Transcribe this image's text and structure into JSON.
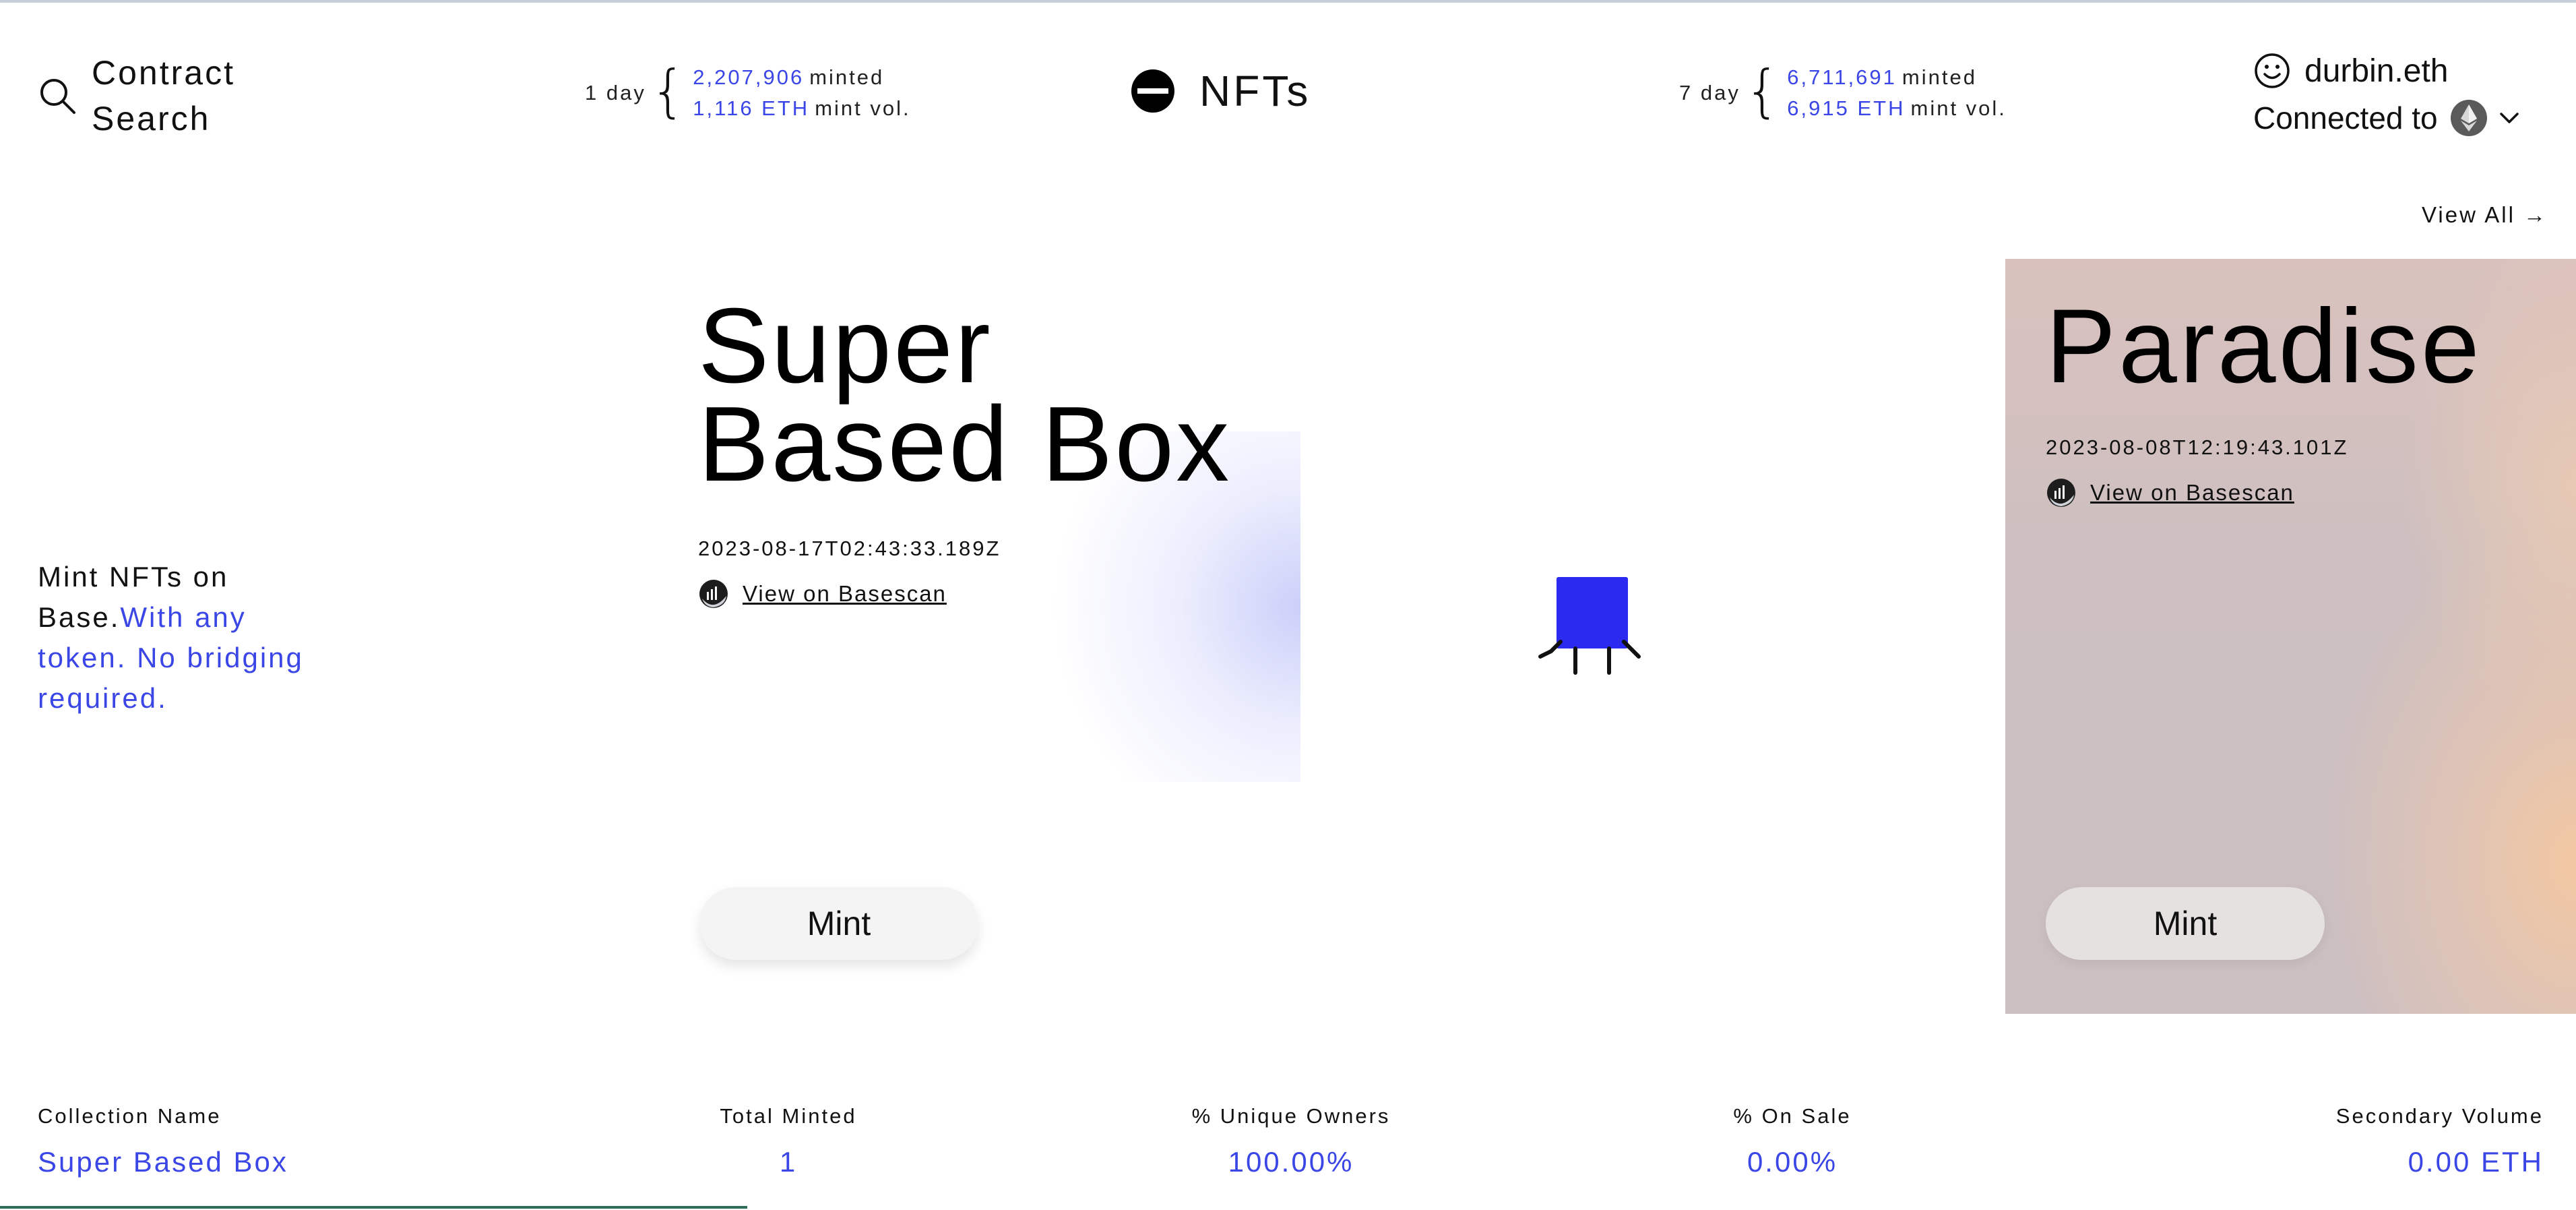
{
  "header": {
    "search_label": "Contract\nSearch",
    "stats_1d": {
      "period": "1 day",
      "minted_value": "2,207,906",
      "minted_label": "minted",
      "vol_value": "1,116 ETH",
      "vol_label": "mint vol."
    },
    "brand": {
      "label": "NFTs",
      "icon": "minus-circle-icon"
    },
    "stats_7d": {
      "period": "7 day",
      "minted_value": "6,711,691",
      "minted_label": "minted",
      "vol_value": "6,915 ETH",
      "vol_label": "mint vol."
    },
    "account": {
      "name": "durbin.eth",
      "connected_label": "Connected to",
      "network_icon": "ethereum-icon"
    }
  },
  "view_all_label": "View All →",
  "tagline": {
    "part1": "Mint NFTs on Base.",
    "part2": "With any token. No bridging required."
  },
  "featured": {
    "title_line1": "Super",
    "title_line2": "Based Box",
    "date": "2023-08-17T02:43:33.189Z",
    "link_label": "View on Basescan",
    "mint_label": "Mint"
  },
  "next_card": {
    "title": "Paradise",
    "date": "2023-08-08T12:19:43.101Z",
    "link_label": "View on Basescan",
    "mint_label": "Mint"
  },
  "collection_stats": {
    "name_label": "Collection Name",
    "name_value": "Super Based Box",
    "total_label": "Total Minted",
    "total_value": "1",
    "owners_label": "% Unique Owners",
    "owners_value": "100.00%",
    "sale_label": "% On Sale",
    "sale_value": "0.00%",
    "volume_label": "Secondary Volume",
    "volume_value": "0.00 ETH"
  },
  "carousel_progress": 0.29,
  "colors": {
    "accent": "#3b46e6",
    "nft_box": "#2a2af0",
    "progress": "#2f6e5a"
  }
}
